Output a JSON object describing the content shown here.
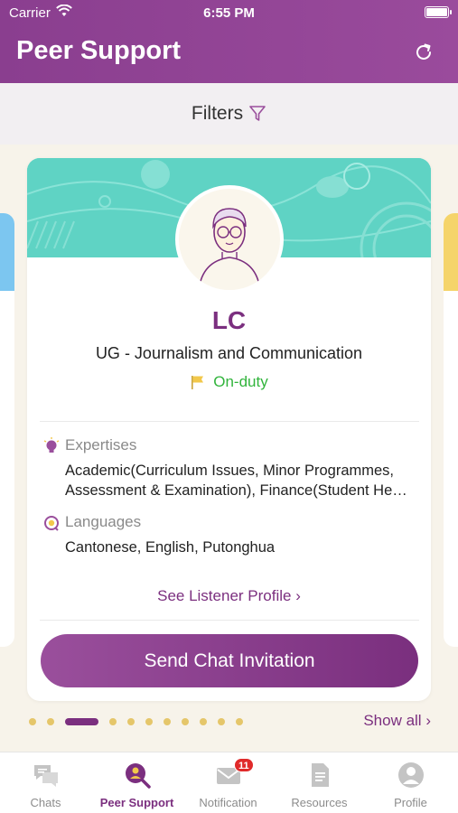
{
  "status_bar": {
    "carrier": "Carrier",
    "time": "6:55 PM"
  },
  "header": {
    "title": "Peer Support"
  },
  "filters": {
    "label": "Filters"
  },
  "card": {
    "name": "LC",
    "program": "UG - Journalism and Communication",
    "status": "On-duty",
    "expertises_label": "Expertises",
    "expertises_value": "Academic(Curriculum Issues, Minor Programmes, Assessment & Examination), Finance(Student He…",
    "languages_label": "Languages",
    "languages_value": "Cantonese, English, Putonghua",
    "see_profile": "See Listener Profile",
    "send_button": "Send Chat Invitation"
  },
  "pagination": {
    "show_all": "Show all",
    "total": 11,
    "active_index": 2
  },
  "tabs": [
    {
      "label": "Chats",
      "icon": "chat-bubbles-icon"
    },
    {
      "label": "Peer Support",
      "icon": "peer-search-icon"
    },
    {
      "label": "Notification",
      "icon": "envelope-icon",
      "badge": "11"
    },
    {
      "label": "Resources",
      "icon": "document-icon"
    },
    {
      "label": "Profile",
      "icon": "person-icon"
    }
  ],
  "colors": {
    "brand_purple": "#7b2f7f",
    "header_purple": "#8a3e8f",
    "banner_teal": "#5fd3c4",
    "on_duty_green": "#31b43c",
    "dot_yellow": "#e5c66a"
  }
}
